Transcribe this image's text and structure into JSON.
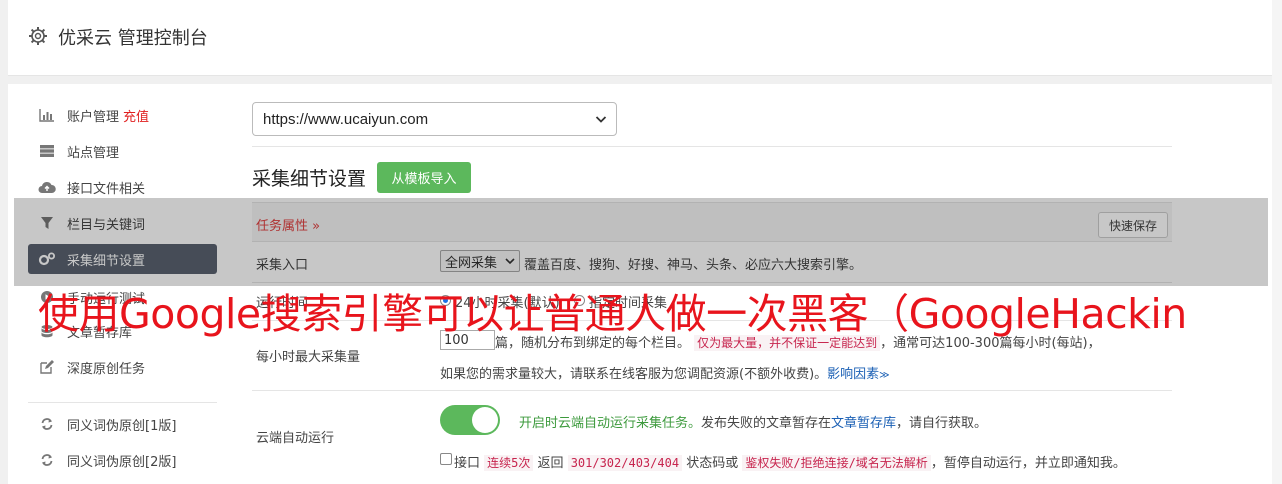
{
  "header": {
    "title": "优采云 管理控制台"
  },
  "sidebar": {
    "items": [
      {
        "label": "账户管理",
        "icon": "bar-chart-icon",
        "extra": "充值"
      },
      {
        "label": "站点管理",
        "icon": "server-icon"
      },
      {
        "label": "接口文件相关",
        "icon": "cloud-upload-icon"
      },
      {
        "label": "栏目与关键词",
        "icon": "filter-icon"
      },
      {
        "label": "采集细节设置",
        "icon": "cogs-icon"
      },
      {
        "label": "手动运行测试",
        "icon": "play-icon"
      },
      {
        "label": "文章暂存库",
        "icon": "database-icon"
      },
      {
        "label": "深度原创任务",
        "icon": "edit-icon"
      },
      {
        "label": "同义词伪原创[1版]",
        "icon": "refresh-icon"
      },
      {
        "label": "同义词伪原创[2版]",
        "icon": "refresh-icon"
      }
    ]
  },
  "main": {
    "site_select": "https://www.ucaiyun.com",
    "section_title": "采集细节设置",
    "import_button": "从模板导入",
    "tab_label": "任务属性 »",
    "save_button": "快速保存",
    "entry": {
      "label": "采集入口",
      "select": "全网采集",
      "desc": "覆盖百度、搜狗、好搜、神马、头条、必应六大搜索引擎。"
    },
    "runtime": {
      "label": "运行时间",
      "opt1": "24小时采集(默认)",
      "opt2": "指定时间采集"
    },
    "max": {
      "label": "每小时最大采集量",
      "value": "100",
      "text1": "篇，随机分布到绑定的每个栏目。",
      "code1": "仅为最大量，并不保证一定能达到",
      "text2": "，通常可达100-300篇每小时(每站)，",
      "text3": "如果您的需求量较大，请联系在线客服为您调配资源(不额外收费)。",
      "link": "影响因素"
    },
    "cloud": {
      "label": "云端自动运行",
      "on_text": "开启时云端自动运行采集任务。",
      "text1": "发布失败的文章暂存在",
      "link": "文章暂存库",
      "text2": "，请自行获取。",
      "cb_text1": "接口",
      "code1": "连续5次",
      "cb_text2": "返回",
      "code2": "301/302/403/404",
      "cb_text3": "状态码或",
      "code3": "鉴权失败/拒绝连接/域名无法解析",
      "cb_text4": "，暂停自动运行，并立即通知我。"
    }
  },
  "banner": {
    "text": "使用Google搜索引擎可以让普通人做一次黑客（GoogleHackin"
  },
  "colors": {
    "accent_green": "#5cb85c",
    "active_sidebar": "#5a6270",
    "danger": "#e02020"
  }
}
